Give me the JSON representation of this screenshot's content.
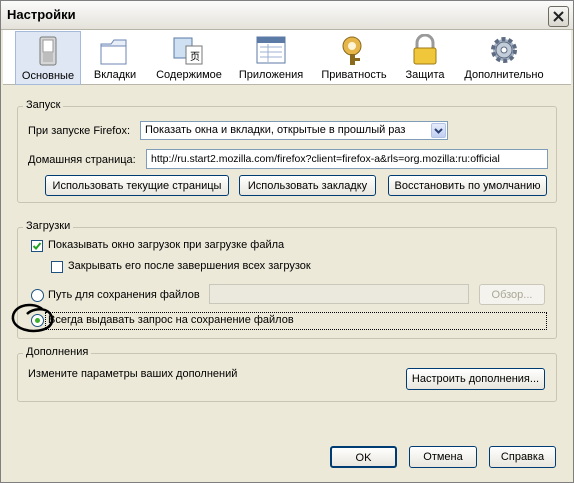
{
  "window": {
    "title": "Настройки"
  },
  "toolbar": {
    "tabs": [
      {
        "label": "Основные",
        "icon": "switch-icon"
      },
      {
        "label": "Вкладки",
        "icon": "tabs-icon"
      },
      {
        "label": "Содержимое",
        "icon": "content-icon"
      },
      {
        "label": "Приложения",
        "icon": "applications-icon"
      },
      {
        "label": "Приватность",
        "icon": "privacy-icon"
      },
      {
        "label": "Защита",
        "icon": "lock-icon"
      },
      {
        "label": "Дополнительно",
        "icon": "gear-icon"
      }
    ],
    "selected": "Основные"
  },
  "startup": {
    "legend": "Запуск",
    "on_start_label": "При запуске Firefox:",
    "on_start_value": "Показать окна и вкладки, открытые в прошлый раз",
    "homepage_label": "Домашняя страница:",
    "homepage_value": "http://ru.start2.mozilla.com/firefox?client=firefox-a&rls=org.mozilla:ru:official",
    "use_current_label": "Использовать текущие страницы",
    "use_bookmark_label": "Использовать закладку",
    "restore_default_label": "Восстановить по умолчанию"
  },
  "downloads": {
    "legend": "Загрузки",
    "show_window_label": "Показывать окно загрузок при загрузке файла",
    "show_window_checked": true,
    "close_window_label": "Закрывать его после завершения всех загрузок",
    "close_window_checked": false,
    "save_path_label": "Путь для сохранения файлов",
    "save_path_value": "",
    "browse_label": "Обзор...",
    "always_ask_label": "Всегда выдавать запрос на сохранение файлов",
    "selected_option": "always_ask"
  },
  "addons": {
    "legend": "Дополнения",
    "description": "Измените параметры ваших дополнений",
    "configure_label": "Настроить дополнения..."
  },
  "footer": {
    "ok_label": "OK",
    "cancel_label": "Отмена",
    "help_label": "Справка"
  },
  "colors": {
    "accent": "#3cb02c",
    "selection": "#dfe7f4",
    "annotation_circle": "#000000"
  }
}
